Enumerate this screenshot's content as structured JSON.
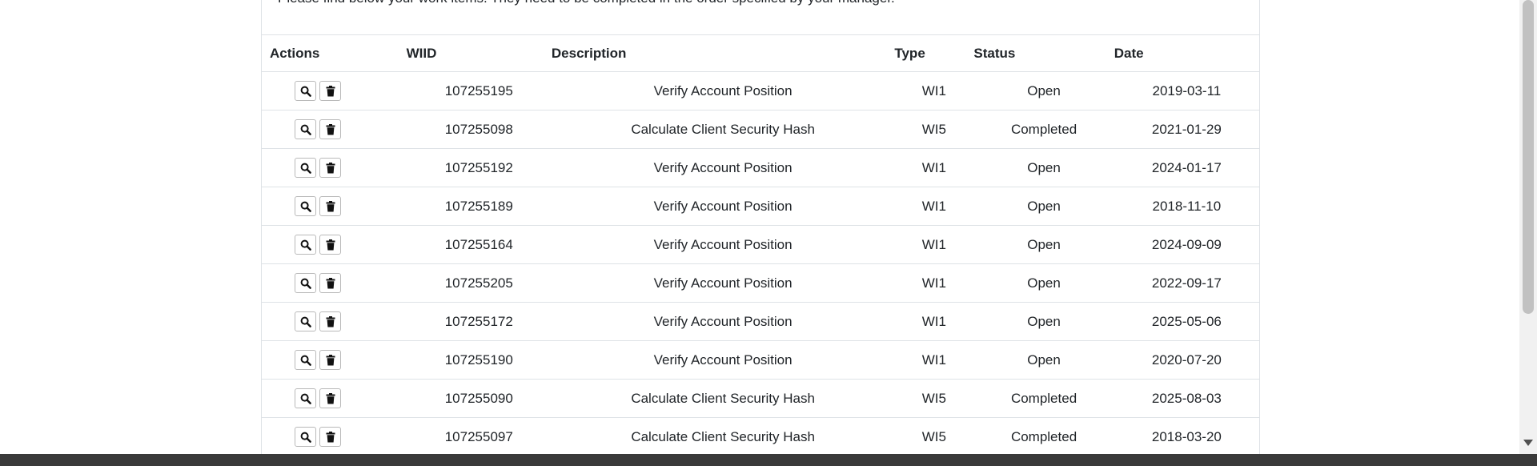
{
  "intro_text": "Please find below your work items. They need to be completed in the order specified by your manager.",
  "table": {
    "headers": {
      "actions": "Actions",
      "wiid": "WIID",
      "description": "Description",
      "type": "Type",
      "status": "Status",
      "date": "Date"
    },
    "rows": [
      {
        "wiid": "107255195",
        "description": "Verify Account Position",
        "type": "WI1",
        "status": "Open",
        "date": "2019-03-11"
      },
      {
        "wiid": "107255098",
        "description": "Calculate Client Security Hash",
        "type": "WI5",
        "status": "Completed",
        "date": "2021-01-29"
      },
      {
        "wiid": "107255192",
        "description": "Verify Account Position",
        "type": "WI1",
        "status": "Open",
        "date": "2024-01-17"
      },
      {
        "wiid": "107255189",
        "description": "Verify Account Position",
        "type": "WI1",
        "status": "Open",
        "date": "2018-11-10"
      },
      {
        "wiid": "107255164",
        "description": "Verify Account Position",
        "type": "WI1",
        "status": "Open",
        "date": "2024-09-09"
      },
      {
        "wiid": "107255205",
        "description": "Verify Account Position",
        "type": "WI1",
        "status": "Open",
        "date": "2022-09-17"
      },
      {
        "wiid": "107255172",
        "description": "Verify Account Position",
        "type": "WI1",
        "status": "Open",
        "date": "2025-05-06"
      },
      {
        "wiid": "107255190",
        "description": "Verify Account Position",
        "type": "WI1",
        "status": "Open",
        "date": "2020-07-20"
      },
      {
        "wiid": "107255090",
        "description": "Calculate Client Security Hash",
        "type": "WI5",
        "status": "Completed",
        "date": "2025-08-03"
      },
      {
        "wiid": "107255097",
        "description": "Calculate Client Security Hash",
        "type": "WI5",
        "status": "Completed",
        "date": "2018-03-20"
      }
    ]
  },
  "icons": {
    "view": "search-icon",
    "delete": "trash-icon"
  }
}
